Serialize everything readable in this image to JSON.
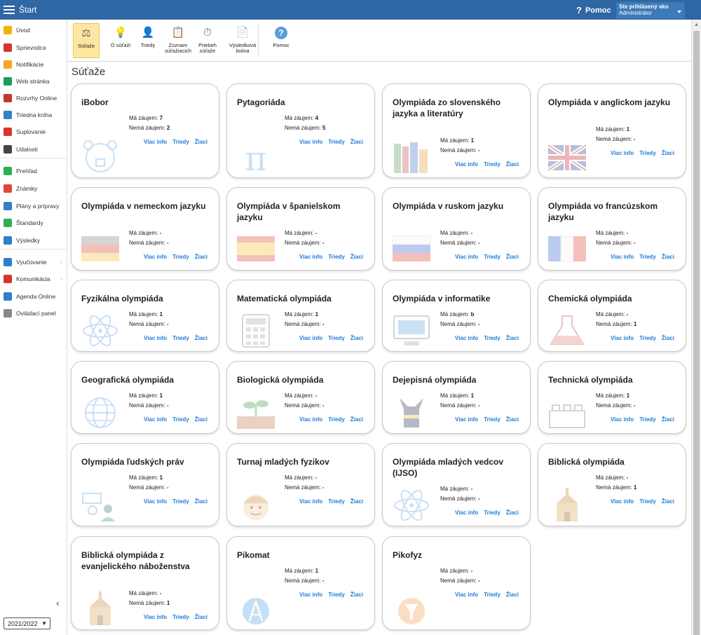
{
  "app": {
    "title": "Štart",
    "help_label": "Pomoc",
    "user_line1": "Ste prihlásený ako",
    "user_line2": "Administrátor"
  },
  "sidebar": {
    "items": [
      {
        "label": "Úvod",
        "color": "#f0b400"
      },
      {
        "label": "Sprievodca",
        "color": "#d9342b"
      },
      {
        "label": "Notifikácie",
        "color": "#f5a623"
      },
      {
        "label": "Web stránka",
        "color": "#1e9c5a"
      },
      {
        "label": "Rozvrhy Online",
        "color": "#c0392b"
      },
      {
        "label": "Triedna kniha",
        "color": "#2f80c9"
      },
      {
        "label": "Suplovanie",
        "color": "#d9342b"
      },
      {
        "label": "Udalosti",
        "color": "#444444"
      },
      {
        "label": "Prehľad",
        "color": "#2fae4f"
      },
      {
        "label": "Známky",
        "color": "#e0453a"
      },
      {
        "label": "Plány a prípravy",
        "color": "#2f80c9"
      },
      {
        "label": "Štandardy",
        "color": "#2fae4f"
      },
      {
        "label": "Výsledky",
        "color": "#2f80c9"
      },
      {
        "label": "Vyučovanie",
        "color": "#2f80c9"
      },
      {
        "label": "Komunikácia",
        "color": "#d9342b"
      },
      {
        "label": "Agenda Online",
        "color": "#2f80c9"
      },
      {
        "label": "Ovládací panel",
        "color": "#888888"
      }
    ],
    "year": "2021/2022"
  },
  "toolbar": {
    "items": [
      {
        "label1": "Súťaže",
        "label2": "",
        "icon": "scales-icon"
      },
      {
        "label1": "O súťaži",
        "label2": "",
        "icon": "bulb-icon"
      },
      {
        "label1": "Triedy",
        "label2": "",
        "icon": "person-icon"
      },
      {
        "label1": "Zoznam",
        "label2": "súťažiacich",
        "icon": "clipboard-icon"
      },
      {
        "label1": "Priebeh",
        "label2": "súťaže",
        "icon": "stopwatch-icon"
      },
      {
        "label1": "Výsledková",
        "label2": "listina",
        "icon": "document-icon"
      },
      {
        "label1": "Pomoc",
        "label2": "",
        "icon": "help-icon"
      }
    ]
  },
  "page": {
    "title": "Súťaže"
  },
  "labels": {
    "interested": "Má záujem:",
    "not_interested": "Nemá záujem:",
    "more_info": "Viac info",
    "classes": "Triedy",
    "students": "Žiaci"
  },
  "cards": [
    {
      "title": "iBobor",
      "interested": "7",
      "not": "2",
      "icon": "beaver-icon"
    },
    {
      "title": "Pytagoriáda",
      "interested": "4",
      "not": "5",
      "icon": "pi-icon"
    },
    {
      "title": "Olympiáda zo slovenského jazyka a literatúry",
      "interested": "1",
      "not": "-",
      "icon": "books-icon"
    },
    {
      "title": "Olympiáda v anglickom jazyku",
      "interested": "1",
      "not": "-",
      "icon": "uk-flag-icon"
    },
    {
      "title": "Olympiáda v nemeckom jazyku",
      "interested": "-",
      "not": "-",
      "icon": "german-flag-icon"
    },
    {
      "title": "Olympiáda v španielskom jazyku",
      "interested": "-",
      "not": "-",
      "icon": "spanish-flag-icon"
    },
    {
      "title": "Olympiáda v ruskom jazyku",
      "interested": "-",
      "not": "-",
      "icon": "russian-flag-icon"
    },
    {
      "title": "Olympiáda vo francúzskom jazyku",
      "interested": "-",
      "not": "-",
      "icon": "french-flag-icon"
    },
    {
      "title": "Fyzikálna olympiáda",
      "interested": "1",
      "not": "-",
      "icon": "atom-icon"
    },
    {
      "title": "Matematická olympiáda",
      "interested": "1",
      "not": "-",
      "icon": "calculator-icon"
    },
    {
      "title": "Olympiáda v informatike",
      "interested": "b",
      "not": "-",
      "icon": "computer-icon"
    },
    {
      "title": "Chemická olympiáda",
      "interested": "-",
      "not": "1",
      "icon": "flask-icon"
    },
    {
      "title": "Geografická olympiáda",
      "interested": "1",
      "not": "-",
      "icon": "globe-icon"
    },
    {
      "title": "Biologická olympiáda",
      "interested": "-",
      "not": "-",
      "icon": "plant-icon"
    },
    {
      "title": "Dejepisná olympiáda",
      "interested": "1",
      "not": "-",
      "icon": "anubis-icon"
    },
    {
      "title": "Technická olympiáda",
      "interested": "1",
      "not": "-",
      "icon": "bricks-icon"
    },
    {
      "title": "Olympiáda ľudských práv",
      "interested": "1",
      "not": "-",
      "icon": "people-icon"
    },
    {
      "title": "Turnaj mladých fyzikov",
      "interested": "-",
      "not": "-",
      "icon": "face-icon"
    },
    {
      "title": "Olympiáda mladých vedcov (IJSO)",
      "interested": "-",
      "not": "-",
      "icon": "atom-icon"
    },
    {
      "title": "Biblická olympiáda",
      "interested": "-",
      "not": "1",
      "icon": "church-icon"
    },
    {
      "title": "Biblická olympiáda z evanjelického náboženstva",
      "interested": "-",
      "not": "1",
      "icon": "church-icon"
    },
    {
      "title": "Pikomat",
      "interested": "1",
      "not": "-",
      "icon": "compass-icon"
    },
    {
      "title": "Pikofyz",
      "interested": "-",
      "not": "-",
      "icon": "pikofyz-icon"
    }
  ]
}
